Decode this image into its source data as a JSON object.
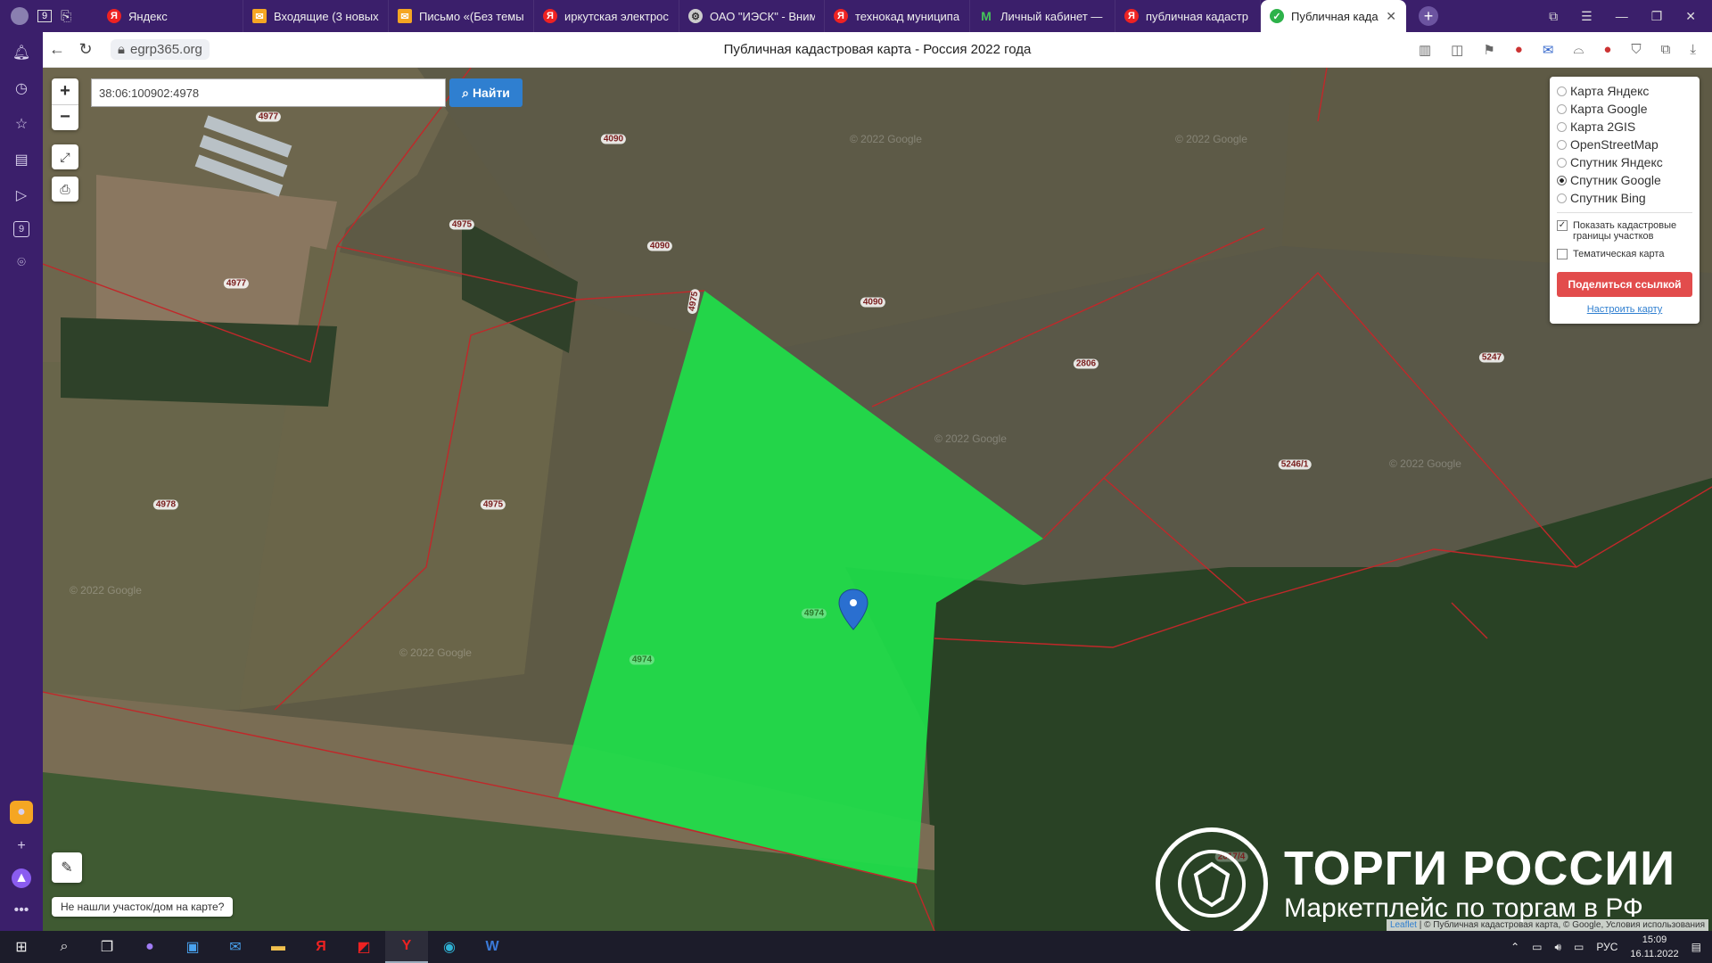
{
  "browser": {
    "tabs": [
      {
        "label": "Яндекс",
        "icon": "yandex-icon"
      },
      {
        "label": "Входящие (3 новых",
        "icon": "mail-icon"
      },
      {
        "label": "Письмо «(Без темы",
        "icon": "mail-icon"
      },
      {
        "label": "иркутская электрос",
        "icon": "yandex-icon"
      },
      {
        "label": "ОАО \"ИЭСК\" - Вним",
        "icon": "iesk-icon"
      },
      {
        "label": "технокад муниципа",
        "icon": "yandex-icon"
      },
      {
        "label": "Личный кабинет —",
        "icon": "m-icon"
      },
      {
        "label": "публичная кадастр",
        "icon": "yandex-icon"
      },
      {
        "label": "Публичная кадас",
        "icon": "check-icon",
        "active": true
      }
    ],
    "tab_counter": "9",
    "url": "egrp365.org",
    "page_title": "Публичная кадастровая карта - Россия 2022 года"
  },
  "map": {
    "search_value": "38:06:100902:4978",
    "search_button": "Найти",
    "zoom_in": "+",
    "zoom_out": "−",
    "layers": [
      {
        "label": "Карта Яндекс",
        "selected": false
      },
      {
        "label": "Карта Google",
        "selected": false
      },
      {
        "label": "Карта 2GIS",
        "selected": false
      },
      {
        "label": "OpenStreetMap",
        "selected": false
      },
      {
        "label": "Спутник Яндекс",
        "selected": false
      },
      {
        "label": "Спутник Google",
        "selected": true
      },
      {
        "label": "Спутник Bing",
        "selected": false
      }
    ],
    "show_borders_label": "Показать кадастровые границы участков",
    "show_borders_checked": "✓",
    "thematic_label": "Тематическая карта",
    "share_button": "Поделиться ссылкой",
    "configure_link": "Настроить карту",
    "not_found_text": "Не нашли участок/дом на карте?",
    "parcel_labels": [
      "4977",
      "4090",
      "4975",
      "4090",
      "4977",
      "4975",
      "4090",
      "2806",
      "5247",
      "5246/1",
      "4978",
      "4975",
      "4974",
      "4974",
      "2017/4"
    ],
    "watermarks": [
      "© 2022 Google",
      "© 2022 Google",
      "© 2022 Google",
      "© 2022 Google",
      "© 2022 Google",
      "© 2022 Google"
    ],
    "attribution_leaflet": "Leaflet",
    "attribution_rest": "| © Публичная кадастровая карта, © Google, Условия использования",
    "watermark_title": "ТОРГИ РОССИИ",
    "watermark_subtitle": "Маркетплейс по торгам в РФ"
  },
  "taskbar": {
    "lang": "РУС",
    "time": "15:09",
    "date": "16.11.2022"
  },
  "colors": {
    "browser_bg": "#3b1f6b",
    "parcel_fill": "#1ee04a",
    "boundary": "#c0282a",
    "search_button": "#2f7fd0",
    "share_button": "#e24c4c"
  }
}
